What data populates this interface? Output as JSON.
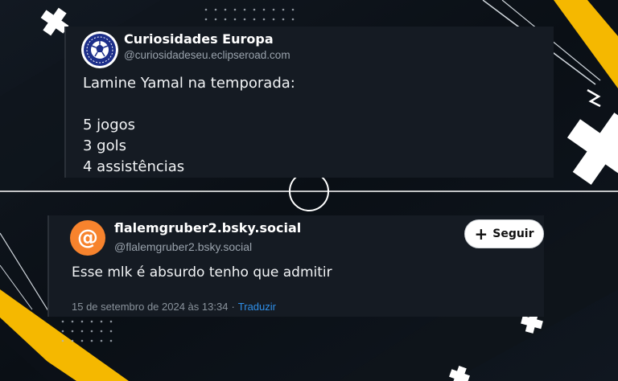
{
  "post1": {
    "author_name": "Curiosidades Europa",
    "author_handle": "@curiosidadeseu.eclipseroad.com",
    "avatar": "soccer-ball-logo",
    "lines": [
      "Lamine Yamal na temporada:",
      "",
      "5 jogos",
      "3 gols",
      "4 assistências"
    ]
  },
  "post2": {
    "author_name": "flalemgruber2.bsky.social",
    "author_handle": "@flalemgruber2.bsky.social",
    "avatar_glyph": "@",
    "follow_label": "Seguir",
    "follow_icon": "+",
    "text": "Esse mlk é absurdo tenho que admitir",
    "date": "15 de setembro de 2024 às 13:34",
    "separator": "·",
    "translate_label": "Traduzir"
  },
  "colors": {
    "background": "#0b1017",
    "card": "#151b23",
    "accent_yellow": "#f5b800",
    "avatar_orange": "#f7832d",
    "link_blue": "#2f8fe8",
    "handle_gray": "#9aa3ad"
  }
}
